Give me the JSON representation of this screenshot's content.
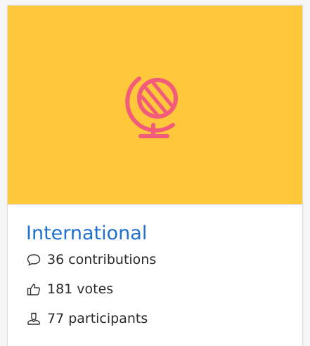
{
  "card": {
    "title": "International",
    "image_icon": "globe-icon",
    "colors": {
      "image_background": "#ffc83a",
      "icon_color": "#f25c7a",
      "title_color": "#1f6fcf"
    },
    "stats": [
      {
        "icon": "comment-icon",
        "count": "36",
        "label": "contributions"
      },
      {
        "icon": "thumbs-up-icon",
        "count": "181",
        "label": "votes"
      },
      {
        "icon": "person-icon",
        "count": "77",
        "label": "participants"
      }
    ]
  }
}
